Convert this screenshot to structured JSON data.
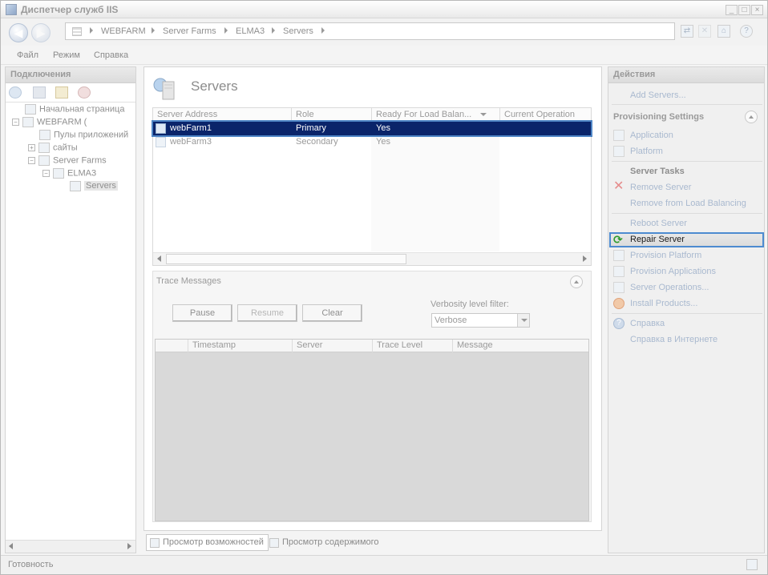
{
  "window": {
    "title": "Диспетчер служб IIS"
  },
  "address": {
    "crumbs": [
      "WEBFARM",
      "Server Farms",
      "ELMA3",
      "Servers"
    ]
  },
  "menu": {
    "items": [
      "Файл",
      "Режим",
      "Справка"
    ]
  },
  "connections": {
    "header": "Подключения",
    "tree": [
      {
        "label": "Начальная страница"
      },
      {
        "label": "WEBFARM ("
      },
      {
        "label": "Пулы приложений"
      },
      {
        "label": "сайты"
      },
      {
        "label": "Server Farms"
      },
      {
        "label": "ELMA3"
      },
      {
        "label": "Servers"
      }
    ]
  },
  "main": {
    "title": "Servers",
    "columns": [
      "Server Address",
      "Role",
      "Ready For Load Balan...",
      "Current Operation"
    ],
    "rows": [
      {
        "address": "webFarm1",
        "role": "Primary",
        "ready": "Yes",
        "op": ""
      },
      {
        "address": "webFarm3",
        "role": "Secondary",
        "ready": "Yes",
        "op": ""
      }
    ],
    "trace": {
      "title": "Trace Messages",
      "buttons": [
        "Pause",
        "Resume",
        "Clear"
      ],
      "verbosity_label": "Verbosity level filter:",
      "verbosity_value": "Verbose",
      "columns": [
        "Timestamp",
        "Server",
        "Trace Level",
        "Message"
      ]
    },
    "tabs": [
      "Просмотр возможностей",
      "Просмотр содержимого"
    ]
  },
  "actions": {
    "header": "Действия",
    "add_servers": "Add Servers...",
    "provisioning_title": "Provisioning Settings",
    "application": "Application",
    "platform": "Platform",
    "server_tasks_title": "Server Tasks",
    "remove_server": "Remove Server",
    "remove_lb": "Remove from Load Balancing",
    "reboot": "Reboot Server",
    "repair": "Repair Server",
    "provision_platform": "Provision Platform",
    "provision_apps": "Provision Applications",
    "server_ops": "Server Operations...",
    "install_products": "Install Products...",
    "help": "Справка",
    "help_online": "Справка в Интернете"
  },
  "status": {
    "text": "Готовность"
  }
}
